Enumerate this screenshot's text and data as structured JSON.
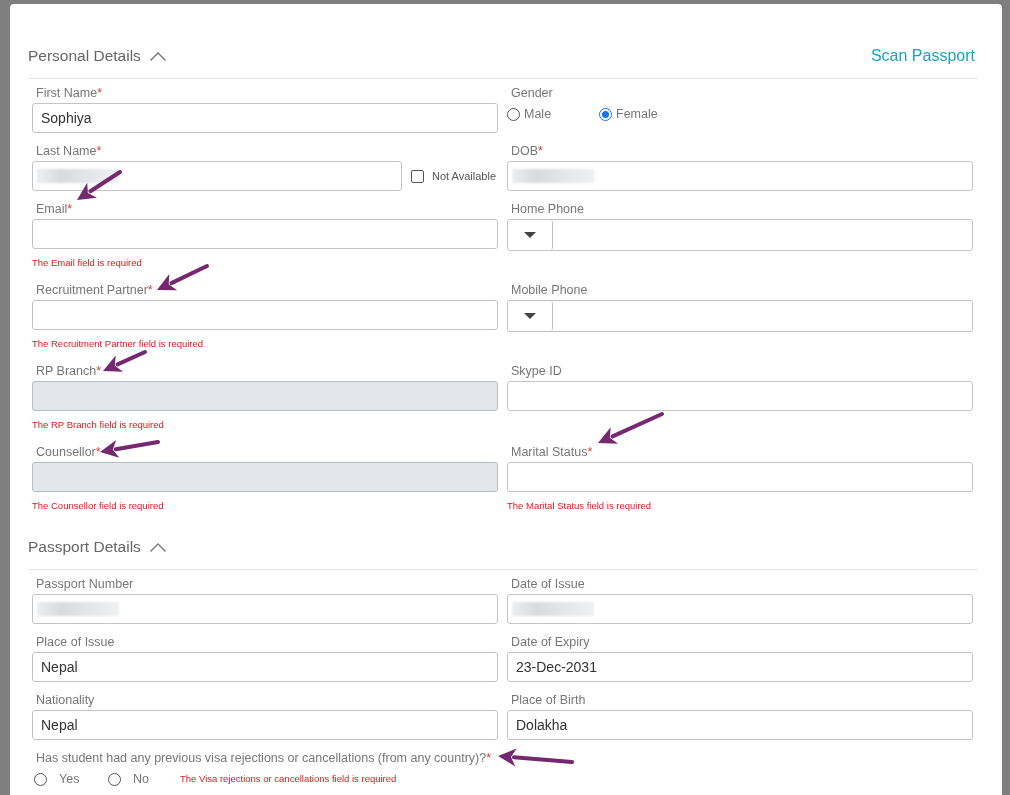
{
  "scan_link": "Scan Passport",
  "sections": [
    {
      "title": "Personal Details",
      "expanded": true,
      "rows": [
        {
          "cells": [
            {
              "kind": "text",
              "label": "First Name",
              "required_mark": "*",
              "value": "Sophiya",
              "disabled": false
            },
            {
              "kind": "radio",
              "label": "Gender",
              "options": [
                {
                  "label": "Male",
                  "selected": false
                },
                {
                  "label": "Female",
                  "selected": true
                }
              ]
            }
          ]
        },
        {
          "cells": [
            {
              "kind": "text",
              "label": "Last Name",
              "required_mark": "*",
              "redacted": true,
              "disabled": false,
              "checkbox": {
                "label": "Not Available",
                "checked": false
              }
            },
            {
              "kind": "text",
              "label": "DOB",
              "required_mark": "*",
              "redacted": true,
              "disabled": false
            }
          ]
        },
        {
          "cells": [
            {
              "kind": "text",
              "label": "Email",
              "required_mark": "*",
              "disabled": false,
              "error": "The Email field is required"
            },
            {
              "kind": "phone",
              "label": "Home Phone"
            }
          ]
        },
        {
          "cells": [
            {
              "kind": "text",
              "label": "Recruitment Partner",
              "required_mark": "*",
              "disabled": false,
              "error": "The Recruitment Partner field is required"
            },
            {
              "kind": "phone",
              "label": "Mobile Phone"
            }
          ]
        },
        {
          "cells": [
            {
              "kind": "text",
              "label": "RP Branch",
              "required_mark": "*",
              "disabled": true,
              "error": "The RP Branch field is required"
            },
            {
              "kind": "text",
              "label": "Skype ID",
              "disabled": false
            }
          ]
        },
        {
          "cells": [
            {
              "kind": "text",
              "label": "Counsellor",
              "required_mark": "*",
              "disabled": true,
              "error": "The Counsellor field is required"
            },
            {
              "kind": "text",
              "label": "Marital Status",
              "required_mark": "*",
              "disabled": false,
              "error": "The Marital Status field is required"
            }
          ]
        }
      ]
    },
    {
      "title": "Passport Details",
      "expanded": true,
      "rows": [
        {
          "cells": [
            {
              "kind": "text",
              "label": "Passport Number",
              "redacted": true,
              "disabled": false
            },
            {
              "kind": "text",
              "label": "Date of Issue",
              "redacted": true,
              "disabled": false
            }
          ]
        },
        {
          "cells": [
            {
              "kind": "text",
              "label": "Place of Issue",
              "value": "Nepal",
              "disabled": false
            },
            {
              "kind": "text",
              "label": "Date of Expiry",
              "value": "23-Dec-2031",
              "disabled": false
            }
          ]
        },
        {
          "cells": [
            {
              "kind": "text",
              "label": "Nationality",
              "value": "Nepal",
              "disabled": false
            },
            {
              "kind": "text",
              "label": "Place of Birth",
              "value": "Dolakha",
              "disabled": false
            }
          ]
        },
        {
          "cells": [
            {
              "kind": "radio",
              "label": "Has student had any previous visa rejections or cancellations (from any country)?",
              "required_mark": "*",
              "options": [
                {
                  "label": "Yes",
                  "selected": false
                },
                {
                  "label": "No",
                  "selected": false
                }
              ],
              "error": "The Visa rejections or cancellations field is required"
            }
          ]
        }
      ]
    }
  ]
}
